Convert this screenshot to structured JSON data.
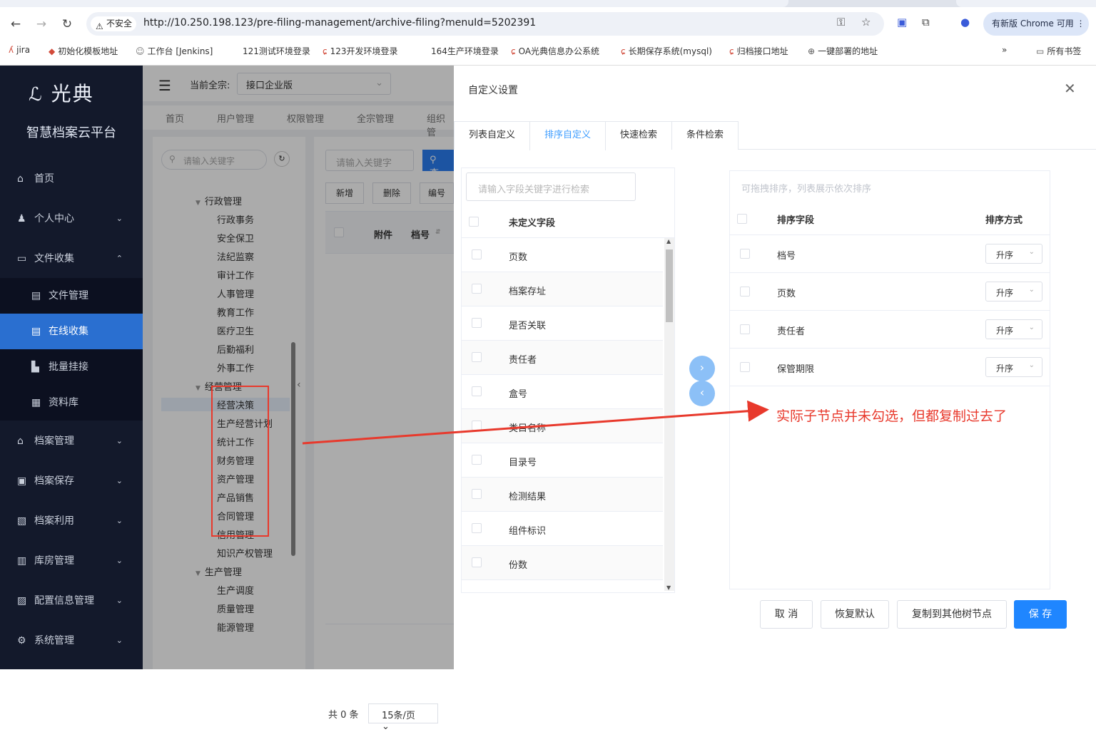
{
  "browser": {
    "insecure_label": "不安全",
    "url": "http://10.250.198.123/pre-filing-management/archive-filing?menuId=5202391",
    "update_label": "有新版 Chrome 可用",
    "bookmarks": [
      "jira",
      "初始化模板地址",
      "工作台 [Jenkins]",
      "121测试环境登录",
      "123开发环境登录",
      "164生产环境登录",
      "OA光典信息办公系统",
      "长期保存系统(mysql)",
      "归档接口地址",
      "一键部署的地址"
    ],
    "all_bookmarks": "所有书签"
  },
  "sidebar": {
    "logo": "光典",
    "subtitle": "智慧档案云平台",
    "items": [
      {
        "label": "首页",
        "icon": "home-icon"
      },
      {
        "label": "个人中心",
        "icon": "user-icon"
      },
      {
        "label": "文件收集",
        "icon": "folder-icon"
      },
      {
        "label": "文件管理",
        "icon": "file-icon"
      },
      {
        "label": "在线收集",
        "icon": "document-icon"
      },
      {
        "label": "批量挂接",
        "icon": "bar-chart-icon"
      },
      {
        "label": "资料库",
        "icon": "calendar-icon"
      },
      {
        "label": "档案管理",
        "icon": "bank-icon"
      },
      {
        "label": "档案保存",
        "icon": "building-icon"
      },
      {
        "label": "档案利用",
        "icon": "clipboard-icon"
      },
      {
        "label": "库房管理",
        "icon": "warehouse-icon"
      },
      {
        "label": "配置信息管理",
        "icon": "config-icon"
      },
      {
        "label": "系统管理",
        "icon": "gear-icon"
      }
    ]
  },
  "main": {
    "fonds_label": "当前全宗:",
    "fonds_value": "接口企业版",
    "tabs": [
      "首页",
      "用户管理",
      "权限管理",
      "全宗管理",
      "组织管"
    ],
    "tree_search_placeholder": "请输入关键字",
    "tree_nodes": [
      {
        "label": "行政管理",
        "level": 1
      },
      {
        "label": "行政事务",
        "level": 2
      },
      {
        "label": "安全保卫",
        "level": 2
      },
      {
        "label": "法纪监察",
        "level": 2
      },
      {
        "label": "审计工作",
        "level": 2
      },
      {
        "label": "人事管理",
        "level": 2
      },
      {
        "label": "教育工作",
        "level": 2
      },
      {
        "label": "医疗卫生",
        "level": 2
      },
      {
        "label": "后勤福利",
        "level": 2
      },
      {
        "label": "外事工作",
        "level": 2
      },
      {
        "label": "经营管理",
        "level": 1
      },
      {
        "label": "经营决策",
        "level": 2
      },
      {
        "label": "生产经营计划",
        "level": 2
      },
      {
        "label": "统计工作",
        "level": 2
      },
      {
        "label": "财务管理",
        "level": 2
      },
      {
        "label": "资产管理",
        "level": 2
      },
      {
        "label": "产品销售",
        "level": 2
      },
      {
        "label": "合同管理",
        "level": 2
      },
      {
        "label": "信用管理",
        "level": 2
      },
      {
        "label": "知识产权管理",
        "level": 2
      },
      {
        "label": "生产管理",
        "level": 1
      },
      {
        "label": "生产调度",
        "level": 2
      },
      {
        "label": "质量管理",
        "level": 2
      },
      {
        "label": "能源管理",
        "level": 2
      }
    ],
    "grid_search_placeholder": "请输入关键字",
    "query_label": "查",
    "buttons": [
      "新增",
      "删除",
      "编号"
    ],
    "columns": [
      "附件",
      "档号"
    ],
    "total": "共 0 条",
    "page_size": "15条/页"
  },
  "drawer": {
    "title": "自定义设置",
    "tabs": [
      "列表自定义",
      "排序自定义",
      "快速检索",
      "条件检索"
    ],
    "active_tab": 1,
    "field_search_placeholder": "请输入字段关键字进行检索",
    "left_header": "未定义字段",
    "left_fields": [
      "页数",
      "档案存址",
      "是否关联",
      "责任者",
      "盒号",
      "类目名称",
      "目录号",
      "检测结果",
      "组件标识",
      "份数"
    ],
    "right_hint": "可拖拽排序，列表展示依次排序",
    "right_headers": {
      "field": "排序字段",
      "order": "排序方式"
    },
    "sort_rows": [
      {
        "field": "档号",
        "order": "升序"
      },
      {
        "field": "页数",
        "order": "升序"
      },
      {
        "field": "责任者",
        "order": "升序"
      },
      {
        "field": "保管期限",
        "order": "升序"
      }
    ],
    "buttons": {
      "cancel": "取 消",
      "reset": "恢复默认",
      "copy": "复制到其他树节点",
      "save": "保 存"
    }
  },
  "annotation": {
    "text": "实际子节点并未勾选，但都复制过去了",
    "color": "#e8392c"
  }
}
